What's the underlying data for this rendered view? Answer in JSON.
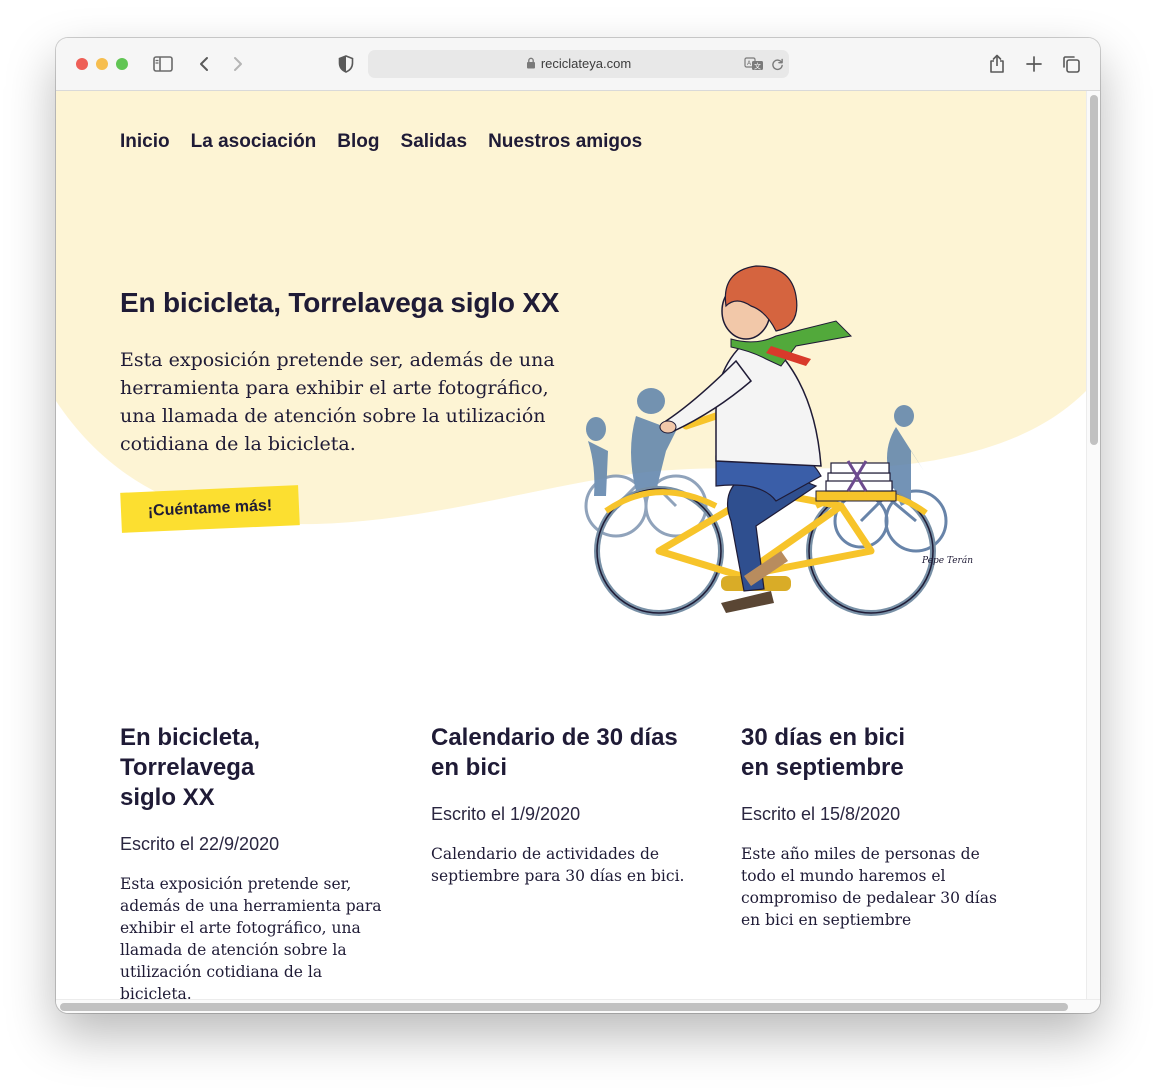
{
  "browser": {
    "url": "reciclateya.com",
    "colors": {
      "close": "#ee5f57",
      "minimize": "#f6be4f",
      "zoom": "#61c554"
    }
  },
  "nav": {
    "items": [
      {
        "label": "Inicio"
      },
      {
        "label": "La asociación"
      },
      {
        "label": "Blog"
      },
      {
        "label": "Salidas"
      },
      {
        "label": "Nuestros amigos"
      }
    ]
  },
  "hero": {
    "title": "En bicicleta, Torrelavega siglo XX",
    "text": "Esta exposición pretende ser, además de una herramienta para exhibir el arte fotográfico, una llamada de atención sobre la utilización cotidiana de la bicicleta.",
    "cta": "¡Cuéntame más!",
    "illustration_signature": "Pepe Terán",
    "colors": {
      "background": "#fdf4d4",
      "cta": "#fcdf30",
      "text": "#1f1b36"
    }
  },
  "posts": [
    {
      "title": "En bicicleta, Torrelavega\nsiglo XX",
      "date": "Escrito el 22/9/2020",
      "excerpt": "Esta exposición pretende ser, además de una herramienta para exhibir el arte fotográfico, una llamada de atención sobre la utilización cotidiana de la bicicleta."
    },
    {
      "title": "Calendario de 30 días\nen bici",
      "date": "Escrito el 1/9/2020",
      "excerpt": "Calendario de actividades de septiembre para 30 días en bici."
    },
    {
      "title": "30 días en bici\nen septiembre",
      "date": "Escrito el 15/8/2020",
      "excerpt": "Este año miles de personas de todo el mundo haremos el compromiso de pedalear 30 días en bici en septiembre"
    }
  ]
}
